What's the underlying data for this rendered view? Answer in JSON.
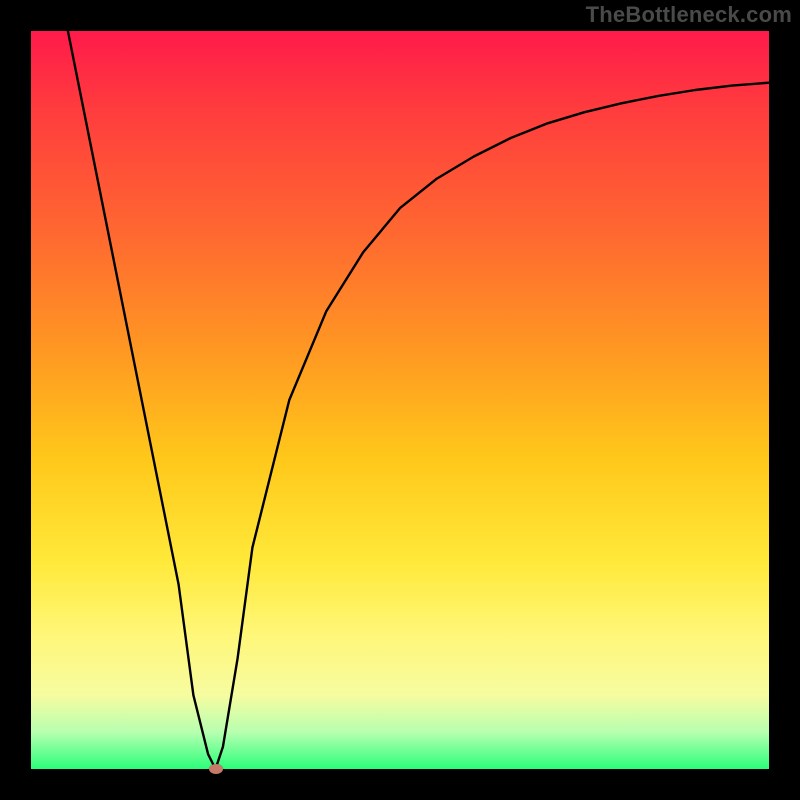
{
  "watermark": "TheBottleneck.com",
  "chart_data": {
    "type": "line",
    "title": "",
    "xlabel": "",
    "ylabel": "",
    "xlim": [
      0,
      100
    ],
    "ylim": [
      0,
      100
    ],
    "grid": false,
    "legend": false,
    "series": [
      {
        "name": "bottleneck-curve",
        "x": [
          5,
          10,
          15,
          20,
          22,
          24,
          25,
          26,
          28,
          30,
          35,
          40,
          45,
          50,
          55,
          60,
          65,
          70,
          75,
          80,
          85,
          90,
          95,
          100
        ],
        "y": [
          100,
          75,
          50,
          25,
          10,
          2,
          0,
          3,
          15,
          30,
          50,
          62,
          70,
          76,
          80,
          83,
          85.5,
          87.5,
          89,
          90.2,
          91.2,
          92,
          92.6,
          93
        ]
      }
    ],
    "annotations": [
      {
        "name": "minimum-marker",
        "x": 25,
        "y": 0,
        "color": "#c77a6a"
      }
    ],
    "background_gradient": {
      "orientation": "vertical",
      "stops": [
        {
          "pos": 0,
          "color": "#ff1a4b"
        },
        {
          "pos": 28,
          "color": "#ff6a30"
        },
        {
          "pos": 58,
          "color": "#ffc81a"
        },
        {
          "pos": 82,
          "color": "#fff77a"
        },
        {
          "pos": 100,
          "color": "#2bff7a"
        }
      ]
    }
  }
}
